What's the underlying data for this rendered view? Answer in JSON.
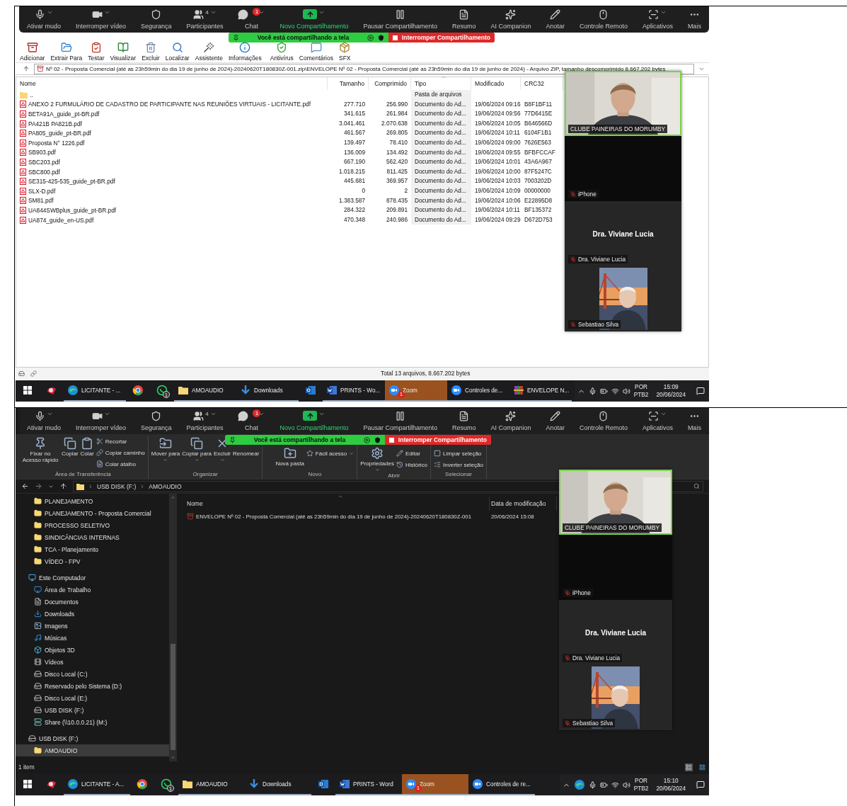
{
  "screens": [
    {
      "zoom_toolbar": [
        {
          "label": "Ativar mudo",
          "dropdown": true,
          "highlighted": false
        },
        {
          "label": "Interromper vídeo",
          "dropdown": true,
          "highlighted": false
        },
        {
          "label": "Segurança",
          "dropdown": false,
          "highlighted": false
        },
        {
          "label": "Participantes",
          "dropdown": true,
          "highlighted": false,
          "count": "4"
        },
        {
          "label": "Chat",
          "dropdown": true,
          "highlighted": false,
          "badge": "1"
        },
        {
          "label": "Novo Compartilhamento",
          "dropdown": true,
          "highlighted": true
        },
        {
          "label": "Pausar Compartilhamento",
          "dropdown": false,
          "highlighted": false
        },
        {
          "label": "Resumo",
          "dropdown": false,
          "highlighted": false
        },
        {
          "label": "AI Companion",
          "dropdown": false,
          "highlighted": false
        },
        {
          "label": "Anotar",
          "dropdown": false,
          "highlighted": false
        },
        {
          "label": "Controle Remoto",
          "dropdown": false,
          "highlighted": false
        },
        {
          "label": "Aplicativos",
          "dropdown": true,
          "highlighted": false
        },
        {
          "label": "Mais",
          "dropdown": false,
          "highlighted": false
        }
      ],
      "sharing_banner": {
        "status": "Você está compartilhando a tela",
        "stop_button": "Interromper Compartilhamento"
      },
      "app": {
        "kind": "winrar",
        "toolbar": [
          {
            "label": "Adicionar"
          },
          {
            "label": "Extrair Para"
          },
          {
            "label": "Testar"
          },
          {
            "label": "Visualizar"
          },
          {
            "label": "Excluir"
          },
          {
            "label": "Localizar"
          },
          {
            "label": "Assistente"
          },
          {
            "label": "Informações"
          },
          {
            "label": "Antivírus"
          },
          {
            "label": "Comentários"
          },
          {
            "label": "SFX"
          }
        ],
        "address": "Nº 02 - Proposta Comercial (até as 23h59min do dia 19 de junho de 2024)-20240620T180830Z-001.zip\\ENVELOPE Nº 02 - Proposta Comercial (até as 23h59min do dia 19 de junho de 2024) - Arquivo ZIP, tamanho descomprimido 8.667.202 bytes",
        "columns": [
          {
            "label": "Nome",
            "sorted": false
          },
          {
            "label": "Tamanho",
            "sorted": false
          },
          {
            "label": "Comprimido",
            "sorted": false
          },
          {
            "label": "Tipo",
            "sorted": true
          },
          {
            "label": "Modificado",
            "sorted": false
          },
          {
            "label": "CRC32",
            "sorted": false
          }
        ],
        "rows": [
          {
            "kind": "folder",
            "name": "..",
            "type": "Pasta de arquivos"
          },
          {
            "kind": "pdf",
            "name": "ANEXO 2 FURMULÁRIO DE CADASTRO DE PARTICIPANTE NAS REUNIÕES VIRTUAIS - LICITANTE.pdf",
            "size": "277.710",
            "packed": "256.990",
            "type": "Documento do Ad...",
            "modified": "19/06/2024 09:16",
            "crc": "B8F1BF11"
          },
          {
            "kind": "pdf",
            "name": "BETA91A_guide_pt-BR.pdf",
            "size": "341.615",
            "packed": "261.984",
            "type": "Documento do Ad...",
            "modified": "19/06/2024 09:56",
            "crc": "77D6415E"
          },
          {
            "kind": "pdf",
            "name": "PA421B PA821B.pdf",
            "size": "3.041.461",
            "packed": "2.070.638",
            "type": "Documento do Ad...",
            "modified": "19/06/2024 10:05",
            "crc": "B646566D"
          },
          {
            "kind": "pdf",
            "name": "PA805_guide_pt-BR.pdf",
            "size": "461.567",
            "packed": "269.805",
            "type": "Documento do Ad...",
            "modified": "19/06/2024 10:11",
            "crc": "6104F1B1"
          },
          {
            "kind": "pdf",
            "name": "Proposta N° 1226.pdf",
            "size": "139.497",
            "packed": "78.410",
            "type": "Documento do Ad...",
            "modified": "19/06/2024 09:00",
            "crc": "7626E563"
          },
          {
            "kind": "pdf",
            "name": "SB903.pdf",
            "size": "136.009",
            "packed": "134.492",
            "type": "Documento do Ad...",
            "modified": "19/06/2024 09:55",
            "crc": "BFBFCCAF"
          },
          {
            "kind": "pdf",
            "name": "SBC203.pdf",
            "size": "667.190",
            "packed": "562.420",
            "type": "Documento do Ad...",
            "modified": "19/06/2024 10:01",
            "crc": "43A6A967"
          },
          {
            "kind": "pdf",
            "name": "SBC800.pdf",
            "size": "1.018.215",
            "packed": "811.425",
            "type": "Documento do Ad...",
            "modified": "19/06/2024 10:00",
            "crc": "87F5247C"
          },
          {
            "kind": "pdf",
            "name": "SE315-425-535_guide_pt-BR.pdf",
            "size": "445.681",
            "packed": "369.957",
            "type": "Documento do Ad...",
            "modified": "19/06/2024 10:03",
            "crc": "7003202D"
          },
          {
            "kind": "pdf",
            "name": "SLX-D.pdf",
            "size": "0",
            "packed": "2",
            "type": "Documento do Ad...",
            "modified": "19/06/2024 10:09",
            "crc": "00000000"
          },
          {
            "kind": "pdf",
            "name": "SM81.pdf",
            "size": "1.383.587",
            "packed": "878.435",
            "type": "Documento do Ad...",
            "modified": "19/06/2024 10:06",
            "crc": "E22895D8"
          },
          {
            "kind": "pdf",
            "name": "UA844SWBplus_guide_pt-BR.pdf",
            "size": "284.322",
            "packed": "209.891",
            "type": "Documento do Ad...",
            "modified": "19/06/2024 10:11",
            "crc": "BF135372"
          },
          {
            "kind": "pdf",
            "name": "UA874_guide_en-US.pdf",
            "size": "470.348",
            "packed": "240.986",
            "type": "Documento do Ad...",
            "modified": "19/06/2024 09:29",
            "crc": "D672D753"
          }
        ],
        "status": "Total 13 arquivos, 8.667.202 bytes"
      },
      "video_panel": [
        {
          "kind": "camera",
          "name": "CLUBE PAINEIRAS DO MORUMBY",
          "muted": false,
          "speaking": true
        },
        {
          "kind": "off",
          "name": "iPhone",
          "muted": true,
          "speaking": false
        },
        {
          "kind": "name",
          "name": "Dra. Viviane Lucia",
          "display_name": "Dra. Viviane Lucia",
          "muted": true,
          "speaking": false
        },
        {
          "name": "Sebastiao Silva",
          "muted": true,
          "speaking": false
        }
      ],
      "taskbar": {
        "items": [
          {
            "kind": "app",
            "running": false,
            "active": false
          },
          {
            "kind": "edge",
            "label": "LICITANTE - ...",
            "running": true,
            "active": false
          },
          {
            "kind": "chrome",
            "running": false,
            "active": false
          },
          {
            "kind": "whatsapp",
            "badge": "1",
            "running": false,
            "active": false
          },
          {
            "kind": "folder",
            "label": "AMOAUDIO",
            "running": true,
            "active": false
          },
          {
            "kind": "download",
            "label": "Downloads",
            "running": true,
            "active": false
          },
          {
            "kind": "outlook",
            "running": false,
            "active": false
          },
          {
            "kind": "word",
            "label": "PRINTS - Wo...",
            "running": true,
            "active": false
          },
          {
            "kind": "zoom",
            "label": "Zoom",
            "badge": "1",
            "running": true,
            "active": true
          },
          {
            "kind": "zoom",
            "label": "Controles de...",
            "running": true,
            "active": false
          },
          {
            "kind": "winrar",
            "label": "ENVELOPE N...",
            "running": true,
            "active": false
          }
        ],
        "tray": {
          "edge_pinned": false,
          "language": "POR",
          "layout": "PTB2",
          "time": "15:09",
          "date": "20/06/2024"
        }
      }
    },
    {
      "zoom_toolbar": [
        {
          "label": "Ativar mudo",
          "dropdown": true,
          "highlighted": false
        },
        {
          "label": "Interromper vídeo",
          "dropdown": true,
          "highlighted": false
        },
        {
          "label": "Segurança",
          "dropdown": false,
          "highlighted": false
        },
        {
          "label": "Participantes",
          "dropdown": true,
          "highlighted": false,
          "count": "4"
        },
        {
          "label": "Chat",
          "dropdown": true,
          "highlighted": false,
          "badge": "1"
        },
        {
          "label": "Novo Compartilhamento",
          "dropdown": true,
          "highlighted": true
        },
        {
          "label": "Pausar Compartilhamento",
          "dropdown": false,
          "highlighted": false
        },
        {
          "label": "Resumo",
          "dropdown": false,
          "highlighted": false
        },
        {
          "label": "AI Companion",
          "dropdown": false,
          "highlighted": false
        },
        {
          "label": "Anotar",
          "dropdown": false,
          "highlighted": false
        },
        {
          "label": "Controle Remoto",
          "dropdown": false,
          "highlighted": false
        },
        {
          "label": "Aplicativos",
          "dropdown": true,
          "highlighted": false
        },
        {
          "label": "Mais",
          "dropdown": false,
          "highlighted": false
        }
      ],
      "sharing_banner": {
        "status": "Você está compartilhando a tela",
        "stop_button": "Interromper Compartilhamento"
      },
      "app": {
        "kind": "explorer",
        "ribbon": [
          {
            "label": "Área de Transferência",
            "buttons": [
              {
                "label": "Fixar no Acesso rápido",
                "kind": "large",
                "dropdown": false
              },
              {
                "label": "Copiar",
                "kind": "large",
                "dropdown": false
              },
              {
                "label": "Colar",
                "kind": "large",
                "dropdown": false
              },
              {
                "label": "Recortar",
                "kind": "small",
                "dropdown": false
              },
              {
                "label": "Copiar caminho",
                "kind": "small",
                "dropdown": false
              },
              {
                "label": "Colar atalho",
                "kind": "small",
                "dropdown": false
              }
            ]
          },
          {
            "label": "Organizar",
            "buttons": [
              {
                "label": "Mover para",
                "kind": "large",
                "dropdown": true
              },
              {
                "label": "Copiar para",
                "kind": "large",
                "dropdown": true
              },
              {
                "label": "Excluir",
                "kind": "large",
                "dropdown": true
              },
              {
                "label": "Renomear",
                "kind": "large",
                "dropdown": false
              }
            ]
          },
          {
            "label": "Novo",
            "buttons": [
              {
                "label": "Nova pasta",
                "kind": "large",
                "dropdown": false
              },
              {
                "label": "Fácil acesso",
                "kind": "small",
                "dropdown": true
              }
            ]
          },
          {
            "label": "Abrir",
            "buttons": [
              {
                "label": "Propriedades",
                "kind": "large",
                "dropdown": true
              },
              {
                "label": "Editar",
                "kind": "small",
                "dropdown": false
              },
              {
                "label": "Histórico",
                "kind": "small",
                "dropdown": false
              }
            ]
          },
          {
            "label": "Selecionar",
            "buttons": [
              {
                "label": "Limpar seleção",
                "kind": "small",
                "dropdown": false
              },
              {
                "label": "Inverter seleção",
                "kind": "small",
                "dropdown": false
              }
            ]
          }
        ],
        "path": [
          "USB DISK (F:)",
          "AMOAUDIO"
        ],
        "sidebar": [
          {
            "kind": "folder",
            "label": "PLANEJAMENTO",
            "selected": false
          },
          {
            "kind": "folder",
            "label": "PLANEJAMENTO - Proposta Comercial",
            "selected": false
          },
          {
            "kind": "folder",
            "label": "PROCESSO SELETIVO",
            "selected": false
          },
          {
            "kind": "folder",
            "label": "SINDICÂNCIAS INTERNAS",
            "selected": false
          },
          {
            "kind": "folder",
            "label": "TCA - Planejamento",
            "selected": false
          },
          {
            "kind": "folder",
            "label": "VÍDEO - FPV",
            "selected": false
          },
          {
            "kind": "computer",
            "label": "Este Computador",
            "selected": false,
            "children": [
              {
                "kind": "desktop",
                "label": "Área de Trabalho",
                "selected": false
              },
              {
                "kind": "documents",
                "label": "Documentos",
                "selected": false
              },
              {
                "kind": "downloads",
                "label": "Downloads",
                "selected": false
              },
              {
                "kind": "images",
                "label": "Imagens",
                "selected": false
              },
              {
                "kind": "music",
                "label": "Músicas",
                "selected": false
              },
              {
                "kind": "objects",
                "label": "Objetos 3D",
                "selected": false
              },
              {
                "kind": "videos",
                "label": "Vídeos",
                "selected": false
              },
              {
                "kind": "drive",
                "label": "Disco Local (C:)",
                "selected": false
              },
              {
                "kind": "drive",
                "label": "Reservado pelo Sistema (D:)",
                "selected": false
              },
              {
                "kind": "drive",
                "label": "Disco Local (E:)",
                "selected": false
              },
              {
                "kind": "drive",
                "label": "USB DISK (F:)",
                "selected": false
              },
              {
                "kind": "network",
                "label": "Share (\\\\10.0.0.21) (M:)",
                "selected": false
              }
            ]
          },
          {
            "kind": "drive",
            "label": "USB DISK (F:)",
            "selected": false,
            "children": [
              {
                "kind": "folder",
                "label": "AMOAUDIO",
                "selected": true
              }
            ]
          }
        ],
        "columns": [
          {
            "label": "Nome",
            "sorted": true
          },
          {
            "label": "Data de modificação",
            "sorted": false
          }
        ],
        "rows": [
          {
            "name": "ENVELOPE Nº 02 - Proposta Comercial (até as 23h59min do dia 19 de junho de 2024)-20240620T180830Z-001",
            "modified": "20/06/2024 15:08"
          }
        ],
        "status": "1 item"
      },
      "video_panel": [
        {
          "kind": "camera",
          "name": "CLUBE PAINEIRAS DO MORUMBY",
          "muted": false,
          "speaking": true
        },
        {
          "kind": "off",
          "name": "iPhone",
          "muted": true,
          "speaking": false
        },
        {
          "kind": "name",
          "name": "Dra. Viviane Lucia",
          "display_name": "Dra. Viviane Lucia",
          "muted": true,
          "speaking": false
        },
        {
          "name": "Sebastiao Silva",
          "muted": true,
          "speaking": false
        }
      ],
      "taskbar": {
        "items": [
          {
            "kind": "app",
            "running": false,
            "active": false
          },
          {
            "kind": "edge",
            "label": "LICITANTE - A...",
            "running": true,
            "active": false
          },
          {
            "kind": "chrome",
            "running": false,
            "active": false
          },
          {
            "kind": "whatsapp",
            "badge": "1",
            "running": false,
            "active": false
          },
          {
            "kind": "folder",
            "label": "AMOAUDIO",
            "running": true,
            "active": false
          },
          {
            "kind": "download",
            "label": "Downloads",
            "running": true,
            "active": false
          },
          {
            "kind": "outlook",
            "running": false,
            "active": false
          },
          {
            "kind": "word",
            "label": "PRINTS - Word",
            "running": true,
            "active": false
          },
          {
            "kind": "zoom",
            "label": "Zoom",
            "badge": "1",
            "running": true,
            "active": true
          },
          {
            "kind": "zoom",
            "label": "Controles de re...",
            "running": true,
            "active": false
          }
        ],
        "tray": {
          "edge_pinned": true,
          "language": "POR",
          "layout": "PTB2",
          "time": "15:10",
          "date": "20/06/2024"
        }
      }
    }
  ]
}
